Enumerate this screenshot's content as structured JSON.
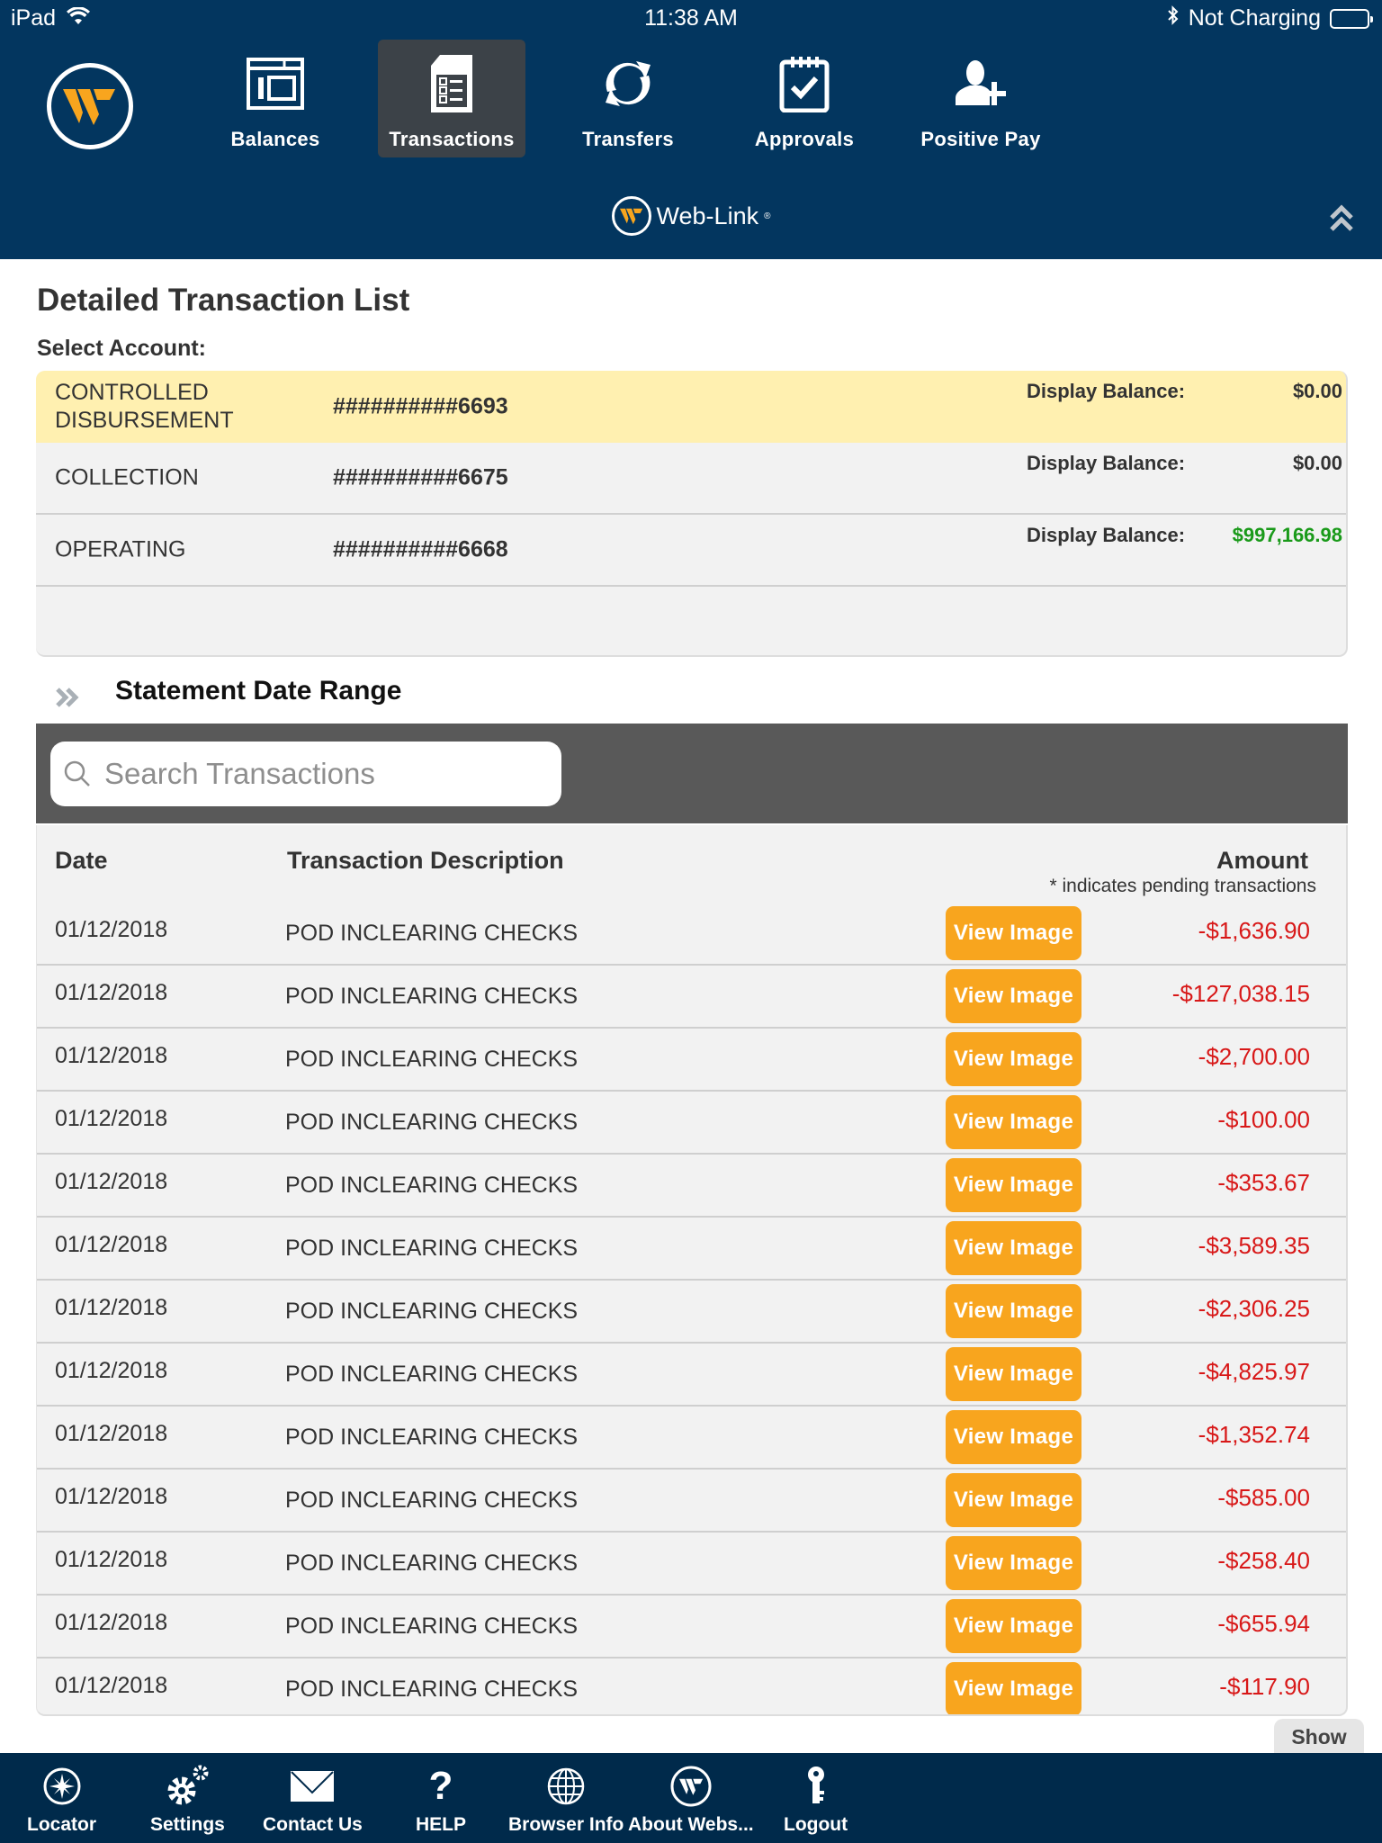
{
  "status_bar": {
    "device": "iPad",
    "time": "11:38 AM",
    "charging": "Not Charging"
  },
  "header": {
    "brand": "Web-Link",
    "brand_mark": "®",
    "nav": [
      {
        "label": "Balances",
        "icon": "balances-icon",
        "active": false
      },
      {
        "label": "Transactions",
        "icon": "transactions-icon",
        "active": true
      },
      {
        "label": "Transfers",
        "icon": "transfers-icon",
        "active": false
      },
      {
        "label": "Approvals",
        "icon": "approvals-icon",
        "active": false
      },
      {
        "label": "Positive Pay",
        "icon": "positive-pay-icon",
        "active": false
      }
    ]
  },
  "main": {
    "title": "Detailed Transaction List",
    "select_account_label": "Select Account:",
    "accounts": [
      {
        "name": "CONTROLLED DISBURSEMENT",
        "number": "##########6693",
        "balance_label": "Display Balance:",
        "balance": "$0.00",
        "selected": true
      },
      {
        "name": "COLLECTION",
        "number": "##########6675",
        "balance_label": "Display Balance:",
        "balance": "$0.00",
        "selected": false
      },
      {
        "name": "OPERATING",
        "number": "##########6668",
        "balance_label": "Display Balance:",
        "balance": "$997,166.98",
        "selected": false
      }
    ],
    "date_range_label": "Statement Date Range",
    "search_placeholder": "Search Transactions",
    "search_value": "",
    "table": {
      "headers": {
        "date": "Date",
        "description": "Transaction Description",
        "amount": "Amount",
        "note": "* indicates pending transactions"
      },
      "view_button_label": "View Image",
      "rows": [
        {
          "date": "01/12/2018",
          "description": "POD INCLEARING CHECKS",
          "amount": "-$1,636.90"
        },
        {
          "date": "01/12/2018",
          "description": "POD INCLEARING CHECKS",
          "amount": "-$127,038.15"
        },
        {
          "date": "01/12/2018",
          "description": "POD INCLEARING CHECKS",
          "amount": "-$2,700.00"
        },
        {
          "date": "01/12/2018",
          "description": "POD INCLEARING CHECKS",
          "amount": "-$100.00"
        },
        {
          "date": "01/12/2018",
          "description": "POD INCLEARING CHECKS",
          "amount": "-$353.67"
        },
        {
          "date": "01/12/2018",
          "description": "POD INCLEARING CHECKS",
          "amount": "-$3,589.35"
        },
        {
          "date": "01/12/2018",
          "description": "POD INCLEARING CHECKS",
          "amount": "-$2,306.25"
        },
        {
          "date": "01/12/2018",
          "description": "POD INCLEARING CHECKS",
          "amount": "-$4,825.97"
        },
        {
          "date": "01/12/2018",
          "description": "POD INCLEARING CHECKS",
          "amount": "-$1,352.74"
        },
        {
          "date": "01/12/2018",
          "description": "POD INCLEARING CHECKS",
          "amount": "-$585.00"
        },
        {
          "date": "01/12/2018",
          "description": "POD INCLEARING CHECKS",
          "amount": "-$258.40"
        },
        {
          "date": "01/12/2018",
          "description": "POD INCLEARING CHECKS",
          "amount": "-$655.94"
        },
        {
          "date": "01/12/2018",
          "description": "POD INCLEARING CHECKS",
          "amount": "-$117.90"
        }
      ]
    },
    "show_button_label": "Show"
  },
  "toolbar": {
    "items": [
      {
        "label": "Locator",
        "icon": "compass-icon"
      },
      {
        "label": "Settings",
        "icon": "gears-icon"
      },
      {
        "label": "Contact Us",
        "icon": "envelope-icon"
      },
      {
        "label": "HELP",
        "icon": "question-icon"
      },
      {
        "label": "Browser Info",
        "icon": "globe-icon"
      },
      {
        "label": "About Webs...",
        "icon": "webster-logo-icon"
      },
      {
        "label": "Logout",
        "icon": "key-icon"
      }
    ]
  },
  "colors": {
    "header_bg": "#03365f",
    "toolbar_bg": "#002a4b",
    "accent_orange": "#f8a51e",
    "selected_row": "#fff0b0",
    "negative_amount": "#d81818",
    "positive_amount": "#1a9a1a"
  }
}
